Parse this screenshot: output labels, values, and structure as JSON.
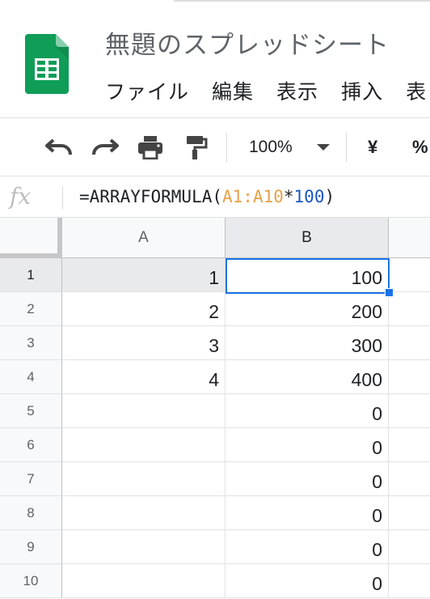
{
  "document": {
    "title": "無題のスプレッドシート"
  },
  "menu": {
    "items": [
      "ファイル",
      "編集",
      "表示",
      "挿入",
      "表"
    ]
  },
  "toolbar": {
    "undo_icon": "undo-icon",
    "redo_icon": "redo-icon",
    "print_icon": "print-icon",
    "paint_format_icon": "paint-format-icon",
    "zoom": "100%",
    "currency": "¥",
    "percent": "%"
  },
  "formula_bar": {
    "fx_label": "fx",
    "parts": {
      "fn": "=ARRAYFORMULA(",
      "ref": "A1:A10",
      "op": "*",
      "num": "100",
      "close": ")"
    }
  },
  "grid": {
    "columns": [
      "A",
      "B"
    ],
    "selected_column": "B",
    "selected_cell": "B1",
    "rows": [
      {
        "n": "1",
        "a": "1",
        "b": "100"
      },
      {
        "n": "2",
        "a": "2",
        "b": "200"
      },
      {
        "n": "3",
        "a": "3",
        "b": "300"
      },
      {
        "n": "4",
        "a": "4",
        "b": "400"
      },
      {
        "n": "5",
        "a": "",
        "b": "0"
      },
      {
        "n": "6",
        "a": "",
        "b": "0"
      },
      {
        "n": "7",
        "a": "",
        "b": "0"
      },
      {
        "n": "8",
        "a": "",
        "b": "0"
      },
      {
        "n": "9",
        "a": "",
        "b": "0"
      },
      {
        "n": "10",
        "a": "",
        "b": "0"
      }
    ]
  },
  "colors": {
    "sheets_green": "#0f9d58",
    "selection_blue": "#1a73e8",
    "reference_orange": "#e8a14a",
    "number_blue": "#1a56c8"
  }
}
